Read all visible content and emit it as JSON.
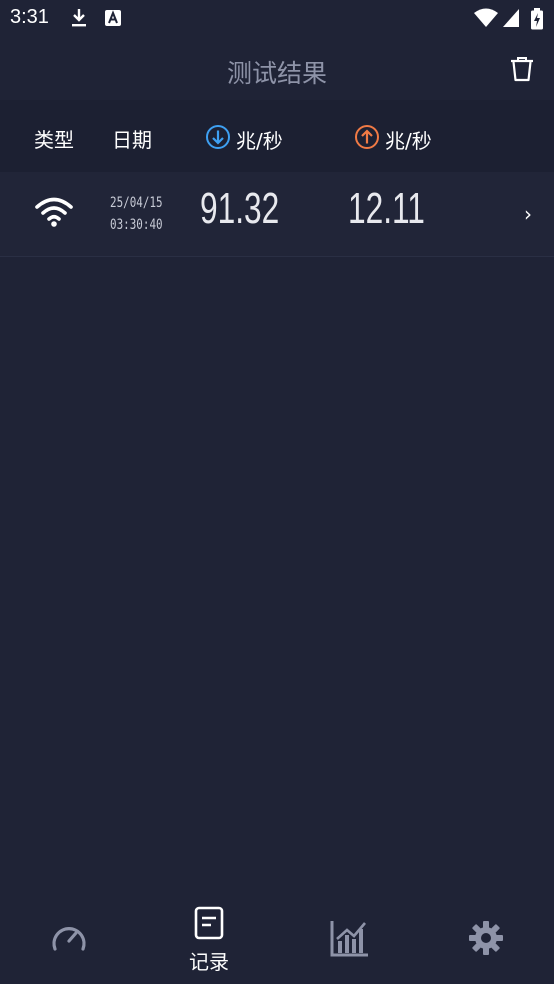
{
  "status_bar": {
    "time": "3:31",
    "icons": [
      "download-icon",
      "a-notification-icon",
      "wifi-signal-icon",
      "cell-signal-icon",
      "battery-charging-icon"
    ]
  },
  "header": {
    "title": "测试结果",
    "delete_icon": "trash-icon"
  },
  "columns": {
    "type": "类型",
    "date": "日期",
    "download": "兆/秒",
    "upload": "兆/秒",
    "download_icon": "download-arrow-icon",
    "upload_icon": "upload-arrow-icon"
  },
  "colors": {
    "background": "#1f2336",
    "download_accent": "#3ea0f2",
    "upload_accent": "#f07a45",
    "title": "#8e93a8"
  },
  "results": [
    {
      "type_icon": "wifi-icon",
      "date": "25/04/15",
      "time": "03:30:40",
      "download": "91.32",
      "upload": "12.11"
    }
  ],
  "bottom_nav": {
    "items": [
      {
        "icon": "speedometer-icon",
        "label": ""
      },
      {
        "icon": "document-icon",
        "label": "记录"
      },
      {
        "icon": "chart-icon",
        "label": ""
      },
      {
        "icon": "gear-icon",
        "label": ""
      }
    ],
    "active_index": 1
  }
}
